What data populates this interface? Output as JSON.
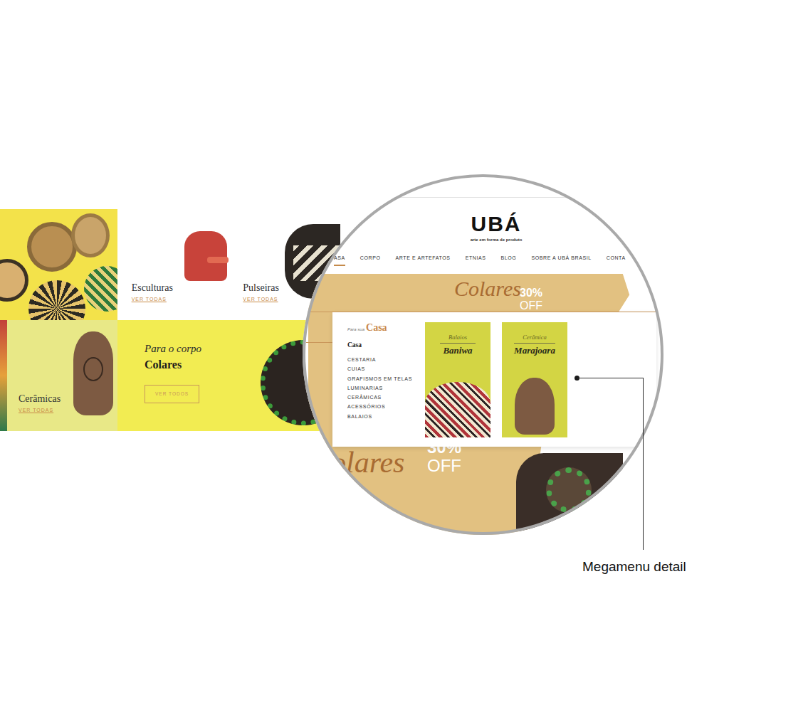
{
  "grid": {
    "tiles": [
      {
        "title": "Esculturas",
        "link": "VER TODAS"
      },
      {
        "title": "Pulseiras",
        "link": "VER TODAS"
      },
      {
        "title": "Cerâmicas",
        "link": "VER TODAS"
      }
    ],
    "promo": {
      "kicker": "Para o corpo",
      "title": "Colares",
      "button": "VER TODOS"
    }
  },
  "magnifier": {
    "logo": "UBÁ",
    "tagline": "arte em forma de produto",
    "nav": [
      {
        "label": "ASA",
        "selected": true
      },
      {
        "label": "CORPO",
        "selected": false
      },
      {
        "label": "ARTE E ARTEFATOS",
        "selected": false
      },
      {
        "label": "ETNIAS",
        "selected": false
      },
      {
        "label": "BLOG",
        "selected": false
      },
      {
        "label": "SOBRE A UBÁ BRASIL",
        "selected": false
      },
      {
        "label": "CONTA",
        "selected": false
      }
    ],
    "banner_top": {
      "script": "Colares",
      "percent": "30%",
      "off": "OFF"
    },
    "banner_bottom": {
      "script": "olares",
      "percent": "30%",
      "off": "OFF"
    },
    "megamenu": {
      "kicker": "Para sua",
      "heading": "Casa",
      "section": "Casa",
      "items": [
        "CESTARIA",
        "CUIAS",
        "GRAFISMOS EM TELAS",
        "LUMINARIAS",
        "CERÂMICAS",
        "ACESSÓRIOS",
        "BALAIOS"
      ],
      "cards": [
        {
          "kicker": "Balaios",
          "title": "Baniwa"
        },
        {
          "kicker": "Cerâmica",
          "title": "Marajoara"
        }
      ]
    }
  },
  "annotation": {
    "label": "Megamenu detail"
  }
}
